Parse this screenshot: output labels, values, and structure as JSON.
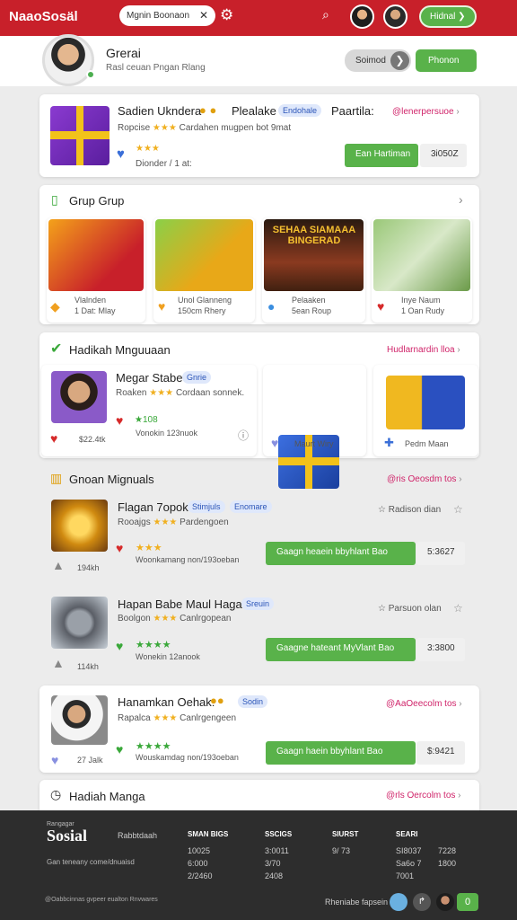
{
  "topbar": {
    "brand": "NaaoSosäl",
    "search_value": "Mgnin Boonaon",
    "button": "Hidnal",
    "bg": "#c8202a"
  },
  "profile": {
    "name": "Grerai",
    "subtitle": "Rasl ceuan Pngan Rlang",
    "btn_secondary": "Soimod",
    "btn_primary": "Phonon"
  },
  "featured": {
    "title": "Sadien Ukndera",
    "title2": "Plealake",
    "tag": "Endohale",
    "extra": "Paartila:",
    "link": "@lenerpersuoe",
    "rating_text": "Ropcise",
    "meta": "Cardahen mugpen bot 9mat",
    "sub": "Dionder / 1 at:",
    "button": "Ean Hartiman",
    "pct": "3i050Z"
  },
  "group": {
    "title": "Grup Grup",
    "items": [
      {
        "title": "Vlalnden",
        "sub": "1 Dat: Mlay"
      },
      {
        "title": "Unol Glanneng",
        "sub": "150cm Rhery"
      },
      {
        "title": "Pelaaken",
        "sub": "5ean Roup"
      },
      {
        "title": "Inye Naum",
        "sub": "1 Oan Rudy"
      }
    ],
    "poster_text": "SEHAA SIAMAAA BINGERAD"
  },
  "hadiah": {
    "title": "Hadikah Mnguuaan",
    "link": "Hudlarnardin lloa",
    "card": {
      "name": "Megar Stabe",
      "tag": "Gnrie",
      "rating_text": "Roaken",
      "meta": "Cordaan sonnek.",
      "likes": "★108",
      "sub": "Vonokin 123nuok",
      "amount": "$22.4tk"
    },
    "items": [
      {
        "label": "Maurt Wiry"
      },
      {
        "label": "Pedm Maan"
      }
    ]
  },
  "gnoan": {
    "title": "Gnoan Mignuals",
    "link": "@ris Oeosdm tos",
    "rows": [
      {
        "title": "Flagan 7opok:",
        "tag1": "Stimjuls",
        "tag2": "Enomare",
        "side": "Radison dian",
        "rating_text": "Rooajgs",
        "meta": "Pardengoen",
        "sub": "Woonkamang non/193oeban",
        "bar": "Gaagn heaein bbyhlant Bao",
        "pct": "5:3627",
        "count": "194kh"
      },
      {
        "title": "Hapan Babe Maul Hagaa",
        "tag1": "Sreuin",
        "side": "Parsuon olan",
        "rating_text": "Boolgon",
        "meta": "Canlrgopean",
        "sub": "Wonekin 12anook",
        "bar": "Gaagne hateant MyVlant Bao",
        "pct": "3:3800",
        "count": "114kh"
      }
    ]
  },
  "third": {
    "title": "Hanamkan Oehak:",
    "tag": "Sodin",
    "link": "@AaOeecolm tos",
    "rating_text": "Rapalca",
    "meta": "Canlrgengeen",
    "sub": "Wouskamdag non/193oeban",
    "bar": "Gaagn haein bbyhlant Bao",
    "pct": "$:9421",
    "count": "27 Jalk"
  },
  "bottom": {
    "title": "Hadiah Manga",
    "link": "@rls Oercolm tos"
  },
  "footer": {
    "brand_small": "Rangagar",
    "brand": "Sosial",
    "about": "Rabbtdaah",
    "tagline": "Gan teneany come/dnuaisd",
    "copyright": "@Oabbcinnas gvpeer eualton Rnvwares",
    "user": "Rheniabe fapsein",
    "cols": [
      {
        "h": "SMAN BIGS",
        "v": [
          "10025",
          "6:000",
          "2/2460"
        ]
      },
      {
        "h": "SSCIGS",
        "v": [
          "3:0011",
          "3/70",
          "2408"
        ]
      },
      {
        "h": "SIURST",
        "v": [
          "9/ 73",
          ""
        ]
      },
      {
        "h": "SEARI",
        "v": [
          "SI8037",
          "Sa6o 7",
          "7001"
        ]
      },
      {
        "h": "",
        "v": [
          "7228",
          "1800"
        ]
      }
    ]
  }
}
